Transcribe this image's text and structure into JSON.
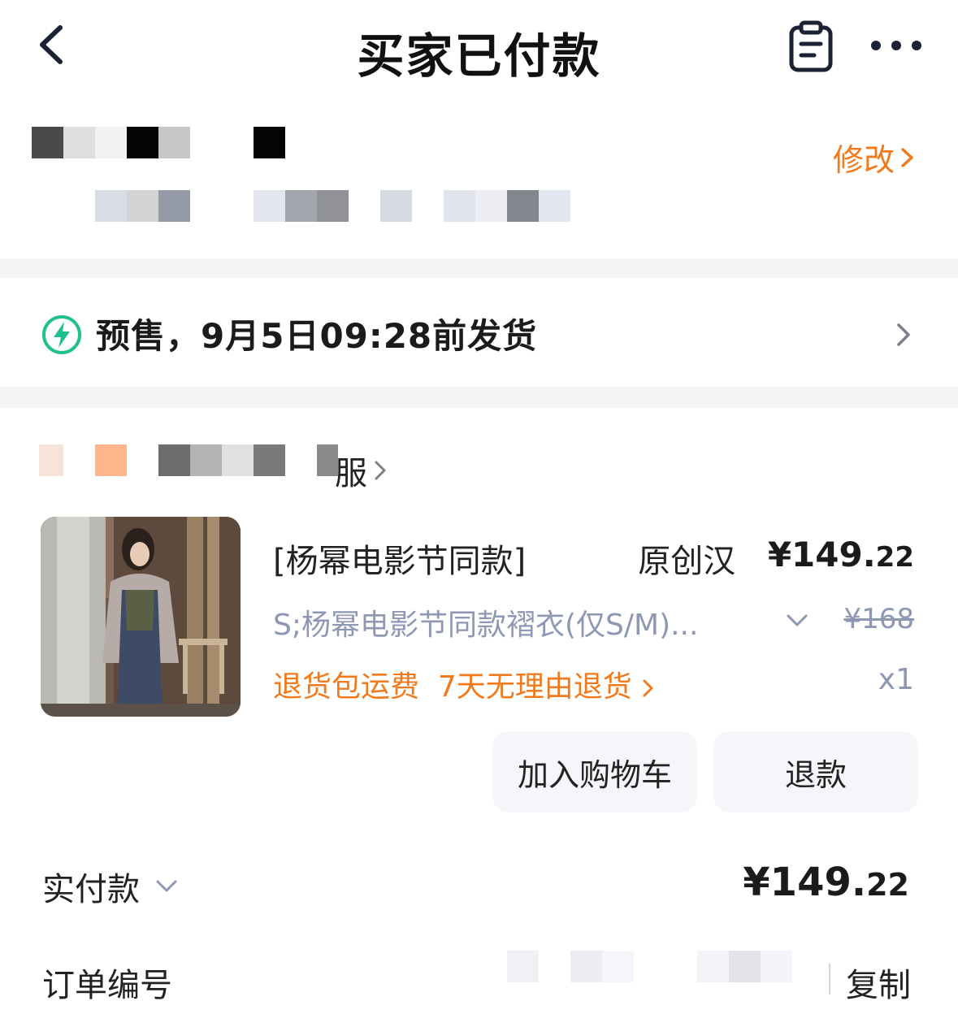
{
  "header": {
    "title": "买家已付款",
    "back_icon": "chevron-left-icon",
    "clipboard_icon": "clipboard-icon",
    "more_icon": "more-dots-icon"
  },
  "address": {
    "modify_label": "修改",
    "modify_color": "#f07a1c"
  },
  "presale": {
    "text": "预售，9月5日09:28前发货",
    "icon": "lightning-icon",
    "icon_color": "#1fbf8f"
  },
  "store": {
    "name_suffix": "服"
  },
  "product": {
    "title": "[杨幂电影节同款]",
    "title_tail": "原创汉",
    "price_main": "¥149.",
    "price_decimal": "22",
    "sku": "S;杨幂电影节同款褶衣(仅S/M)...",
    "original_price": "¥168",
    "tags": "退货包运费  7天无理由退货",
    "quantity": "x1",
    "add_to_cart_label": "加入购物车",
    "refund_label": "退款"
  },
  "summary": {
    "paid_label": "实付款",
    "paid_main": "¥149.",
    "paid_decimal": "22",
    "order_no_label": "订单编号",
    "copy_label": "复制"
  }
}
